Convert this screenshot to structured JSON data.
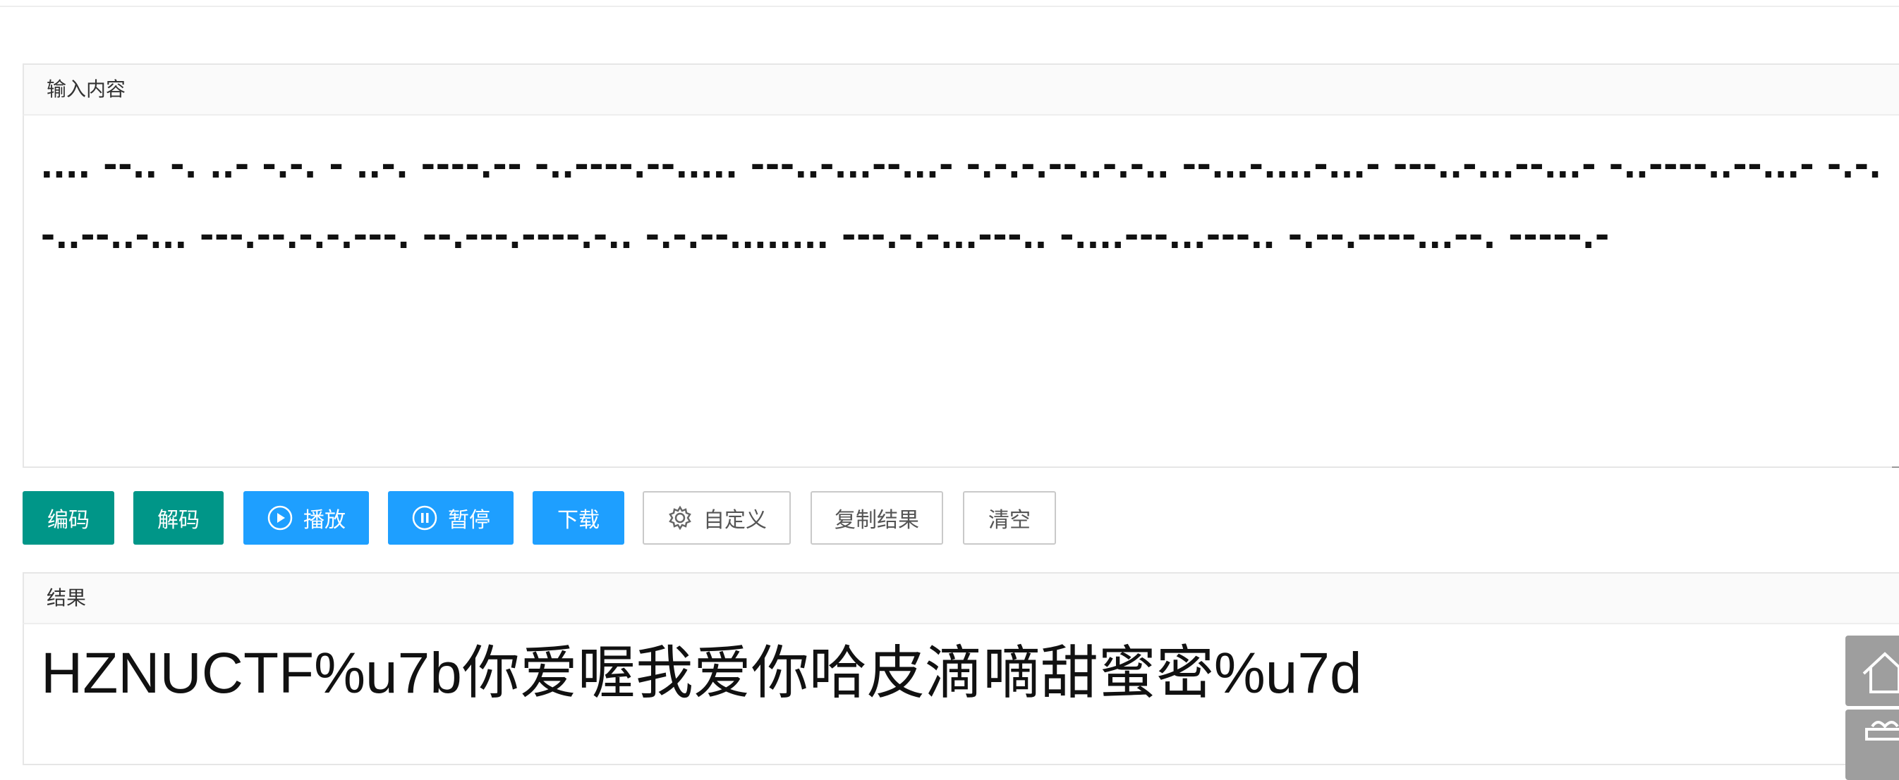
{
  "input": {
    "header": "输入内容",
    "value": ".... --.. -. ..- -.-. - ..-. ----.-- -..----.--..... ---..-...--...- -.-.-.--..-.-.. --...-....-...- ---..-...--...- -..----..--...- -.-.-..--..-... ---.--.-.-.---. --.---.----.-.. -.-.--........ ---.-.-...---.. -....---...---.. -.--.----...--. -----.-"
  },
  "toolbar": {
    "encode": "编码",
    "decode": "解码",
    "play": "播放",
    "pause": "暂停",
    "download": "下载",
    "custom": "自定义",
    "copy": "复制结果",
    "clear": "清空"
  },
  "result": {
    "header": "结果",
    "value": "HZNUCTF%u7b你爱喔我爱你哈皮滴嘀甜蜜密%u7d"
  },
  "colors": {
    "green": "#009688",
    "blue": "#1e9fff",
    "side": "#9e9e9e"
  },
  "icons": {
    "play": "play-circle-icon",
    "pause": "pause-circle-icon",
    "custom": "gear-icon",
    "home": "home-icon",
    "gift": "gift-icon"
  }
}
